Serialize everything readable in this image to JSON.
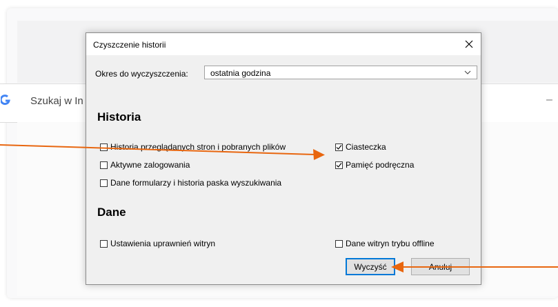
{
  "browser": {
    "search_text": "Szukaj w In",
    "search_dash": "–"
  },
  "dialog": {
    "title": "Czyszczenie historii",
    "range_label": "Okres do wyczyszczenia:",
    "range_value": "ostatnia godzina",
    "history_heading": "Historia",
    "history_items": [
      {
        "label": "Historia przeglądanych stron i pobranych plików",
        "checked": false
      },
      {
        "label": "Aktywne zalogowania",
        "checked": false
      },
      {
        "label": "Dane formularzy i historia paska wyszukiwania",
        "checked": false
      },
      {
        "label": "Ciasteczka",
        "checked": true
      },
      {
        "label": "Pamięć podręczna",
        "checked": true
      }
    ],
    "data_heading": "Dane",
    "data_items": [
      {
        "label": "Ustawienia uprawnień witryn",
        "checked": false
      },
      {
        "label": "Dane witryn trybu offline",
        "checked": false
      }
    ],
    "clear_button": "Wyczyść",
    "cancel_button": "Anuluj"
  },
  "colors": {
    "arrow": "#e8660f",
    "focus_border": "#0078d7"
  }
}
